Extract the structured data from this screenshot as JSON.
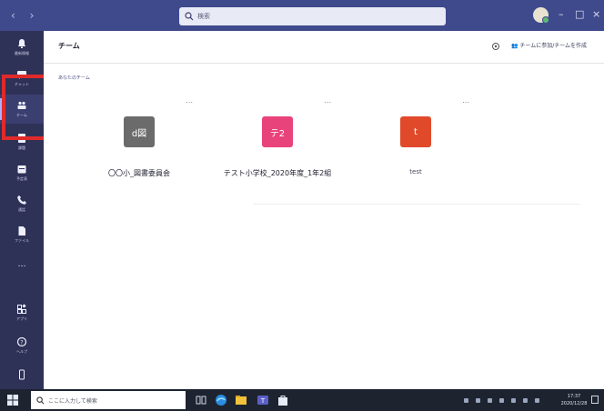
{
  "titlebar": {
    "nav": "‹  ›",
    "search_placeholder": "検索",
    "window_controls": [
      "–",
      "□",
      "×"
    ]
  },
  "rail": {
    "items": [
      {
        "label": "最新情報",
        "icon": "bell-icon"
      },
      {
        "label": "チャット",
        "icon": "chat-icon"
      },
      {
        "label": "チーム",
        "icon": "teams-icon"
      },
      {
        "label": "課題",
        "icon": "assignments-icon"
      },
      {
        "label": "予定表",
        "icon": "calendar-icon"
      },
      {
        "label": "通話",
        "icon": "phone-icon"
      },
      {
        "label": "ファイル",
        "icon": "file-icon"
      },
      {
        "label": "…",
        "icon": "more-icon"
      },
      {
        "label": "アプリ",
        "icon": "apps-icon"
      },
      {
        "label": "ヘルプ",
        "icon": "help-icon"
      },
      {
        "label": "",
        "icon": "device-icon"
      }
    ]
  },
  "main": {
    "title": "チーム",
    "join_create": "チームに参加/チームを作成",
    "section_label": "あなたのチーム",
    "teams": [
      {
        "initial": "d図",
        "name": "〇〇小_図書委員会",
        "color": "#6b6b6b"
      },
      {
        "initial": "テ2",
        "name": "テスト小学校_2020年度_1年2組",
        "color": "#e8437a"
      },
      {
        "initial": "t",
        "name": "test",
        "color": "#e04a2a"
      }
    ],
    "more": "..."
  },
  "taskbar": {
    "search_placeholder": "ここに入力して検索",
    "time": "17:37",
    "date": "2020/12/28"
  }
}
